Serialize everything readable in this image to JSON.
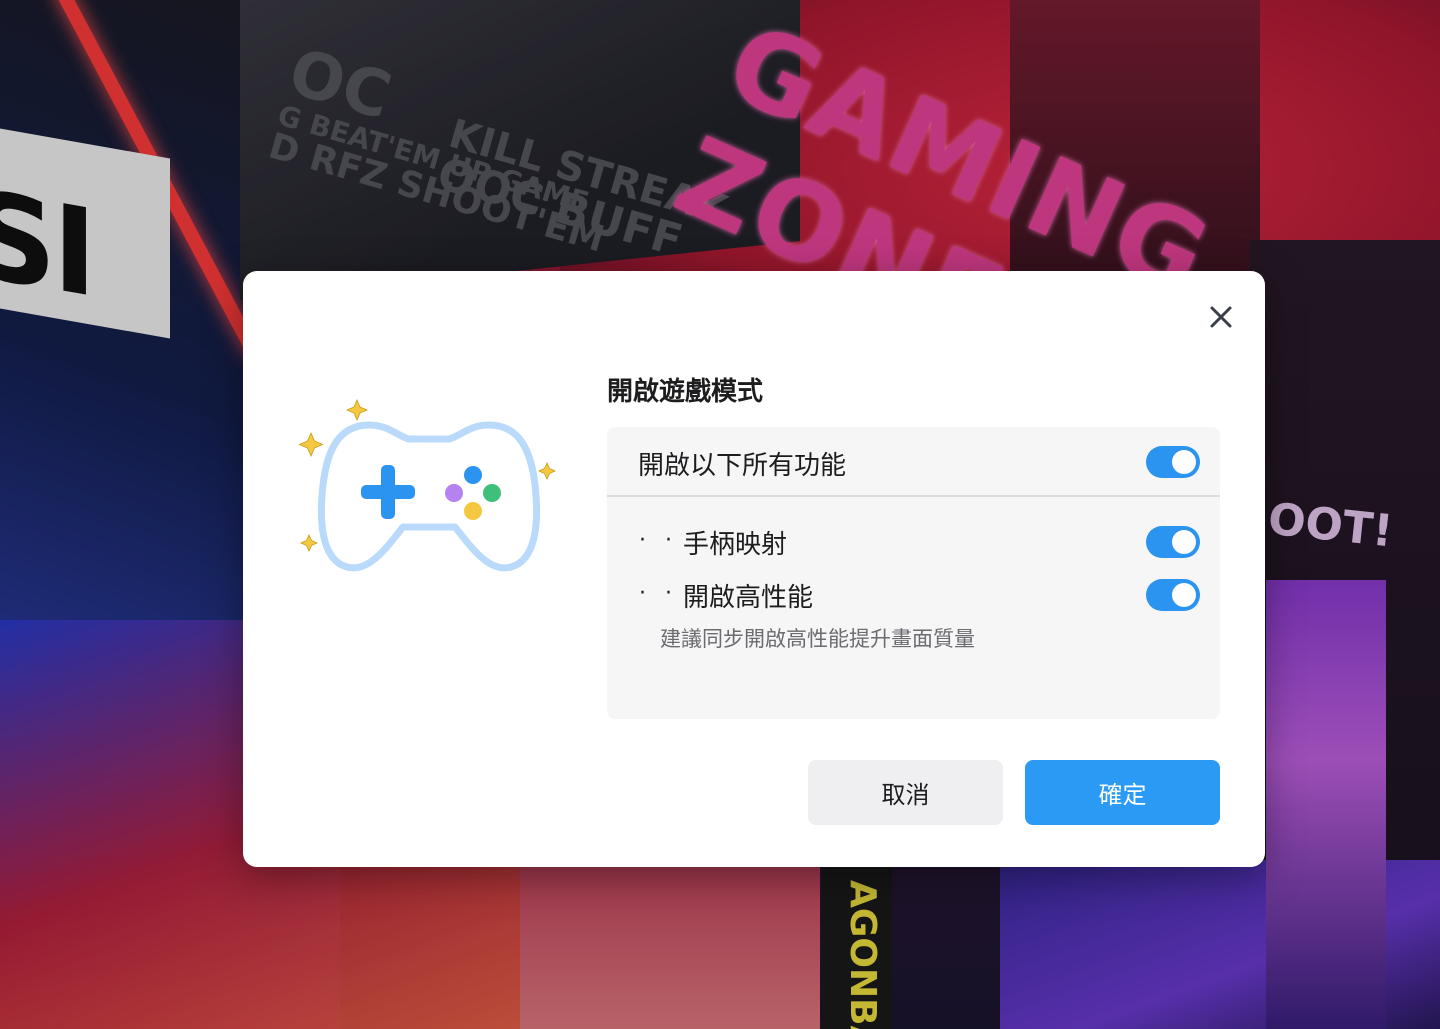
{
  "background": {
    "sign_brand": "SI",
    "sign_gaming": "GAMING ZONE",
    "wall_lines": [
      "OC",
      "G BEAT'EM UP GAME",
      "D RFZ SHOOT'EM",
      "KILL STREAK",
      "OOC BUFF"
    ],
    "billboard_right": "OOT!",
    "billboard_yellow": "AGONBA"
  },
  "dialog": {
    "title": "開啟遊戲模式",
    "close_icon": "close-icon",
    "illustration_icon": "gamepad-icon",
    "accent_color": "#2b93f0",
    "all_features": {
      "label": "開啟以下所有功能",
      "enabled": true
    },
    "options": [
      {
        "bullet": "· ·",
        "label": "手柄映射",
        "enabled": true
      },
      {
        "bullet": "· ·",
        "label": "開啟高性能",
        "enabled": true,
        "hint": "建議同步開啟高性能提升畫面質量"
      }
    ],
    "cancel_label": "取消",
    "confirm_label": "確定"
  }
}
